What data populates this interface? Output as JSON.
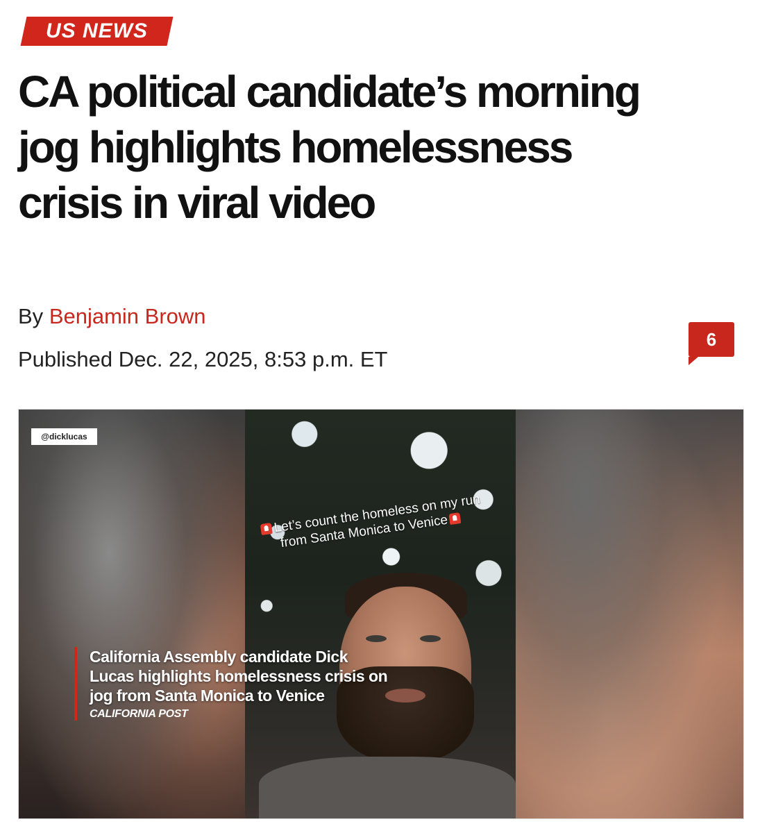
{
  "section": {
    "label": "US NEWS",
    "color": "#d0261c"
  },
  "article": {
    "headline": "CA political candidate’s morning jog highlights homelessness crisis in viral video",
    "byline_prefix": "By",
    "author": "Benjamin Brown",
    "published": "Published Dec. 22, 2025, 8:53 p.m. ET",
    "comment_count": "6"
  },
  "video": {
    "handle": "@dicklucas",
    "overlay_caption": "Let’s count the homeless on my run from Santa Monica to Venice",
    "lower_third_title": "California Assembly candidate Dick Lucas highlights homelessness crisis on jog from Santa Monica to Venice",
    "lower_third_source": "CALIFORNIA POST"
  }
}
